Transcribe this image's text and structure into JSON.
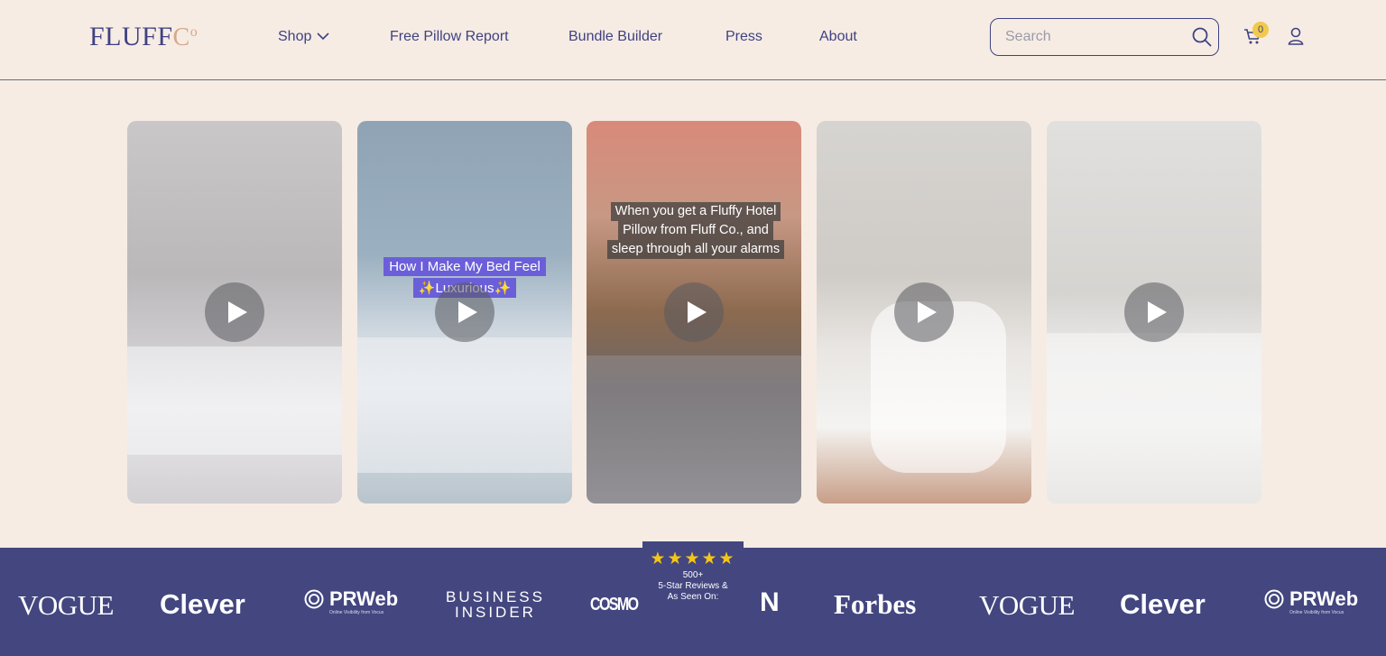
{
  "brand": {
    "logo_main": "FLUFF",
    "logo_co": "C",
    "logo_o": "o"
  },
  "nav": {
    "items": [
      {
        "label": "Shop"
      },
      {
        "label": "Free Pillow Report"
      },
      {
        "label": "Bundle Builder"
      },
      {
        "label": "Press"
      },
      {
        "label": "About"
      }
    ]
  },
  "search": {
    "placeholder": "Search"
  },
  "cart": {
    "count": "0"
  },
  "videos": [
    {
      "caption": ""
    },
    {
      "caption_lines": [
        "How I Make My Bed Feel",
        "✨Luxurious✨"
      ]
    },
    {
      "caption_lines": [
        "When you get a Fluffy Hotel",
        "Pillow from Fluff Co., and",
        "sleep through all your alarms"
      ]
    },
    {
      "caption": ""
    },
    {
      "caption": ""
    }
  ],
  "press": {
    "logos": [
      {
        "name": "VOGUE"
      },
      {
        "name": "Clever"
      },
      {
        "name": "PRWeb",
        "sub": "Online Visibility from Vocus"
      },
      {
        "name_line1": "BUSINESS",
        "name_line2": "INSIDER"
      },
      {
        "name": "COSMO"
      },
      {
        "name": "N"
      },
      {
        "name": "Forbes"
      },
      {
        "name": "VOGUE"
      },
      {
        "name": "Clever"
      },
      {
        "name": "PRWeb",
        "sub": "Online Visibility from Vocus"
      }
    ],
    "reviews": {
      "stars": "★★★★★",
      "count": "500+",
      "line1": "5-Star Reviews &",
      "line2": "As Seen On:"
    }
  },
  "colors": {
    "brand_navy": "#3f4282",
    "background": "#f6ece4",
    "press_bar": "#43467f",
    "accent_peach": "#d6a98a",
    "badge_yellow": "#f2c94c",
    "caption_purple": "#6b5fd9"
  }
}
